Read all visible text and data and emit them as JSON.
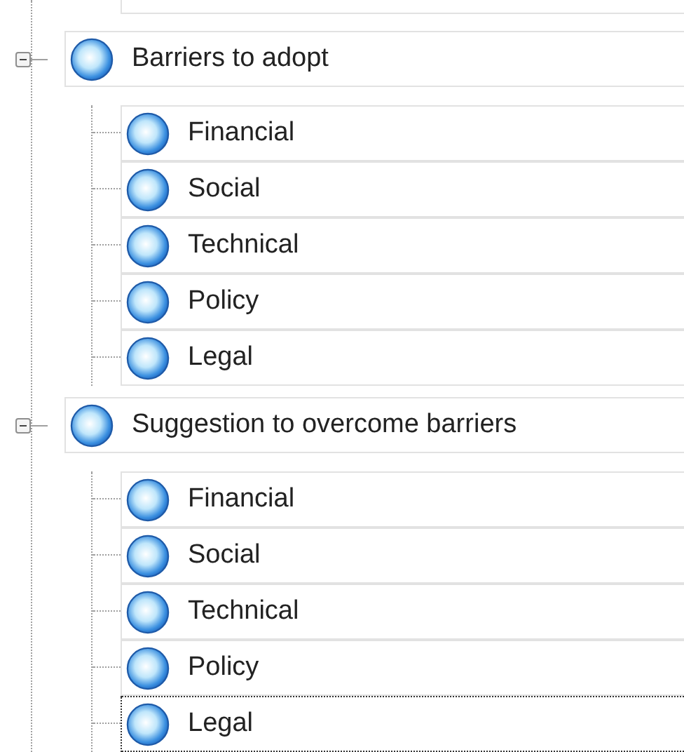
{
  "tree": [
    {
      "label": "Barriers to adopt",
      "expanded": true,
      "selected": false,
      "children": [
        {
          "label": "Financial",
          "selected": false
        },
        {
          "label": "Social",
          "selected": false
        },
        {
          "label": "Technical",
          "selected": false
        },
        {
          "label": "Policy",
          "selected": false
        },
        {
          "label": "Legal",
          "selected": false
        }
      ]
    },
    {
      "label": "Suggestion to overcome barriers",
      "expanded": true,
      "selected": false,
      "children": [
        {
          "label": "Financial",
          "selected": false
        },
        {
          "label": "Social",
          "selected": false
        },
        {
          "label": "Technical",
          "selected": false
        },
        {
          "label": "Policy",
          "selected": false
        },
        {
          "label": "Legal",
          "selected": true
        }
      ]
    }
  ]
}
